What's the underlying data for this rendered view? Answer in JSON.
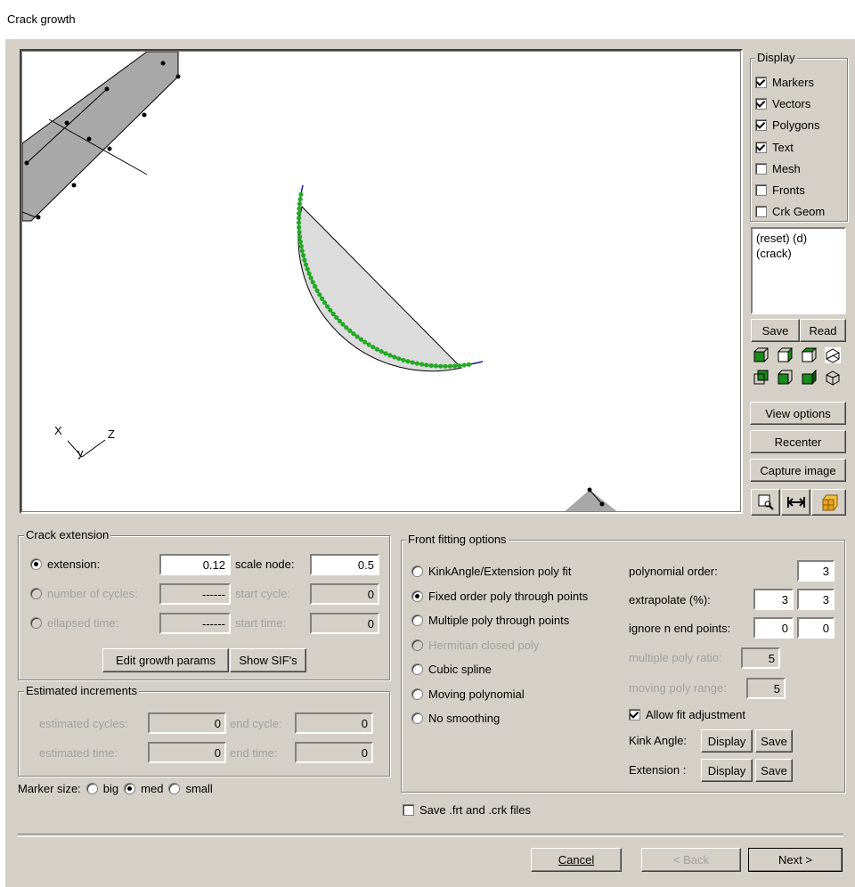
{
  "window": {
    "title": "Crack growth"
  },
  "display": {
    "group_label": "Display",
    "items": [
      {
        "label": "Markers",
        "checked": true
      },
      {
        "label": "Vectors",
        "checked": true
      },
      {
        "label": "Polygons",
        "checked": true
      },
      {
        "label": "Text",
        "checked": true
      },
      {
        "label": "Mesh",
        "checked": false
      },
      {
        "label": "Fronts",
        "checked": false
      },
      {
        "label": "Crk Geom",
        "checked": false
      }
    ],
    "list_items": [
      "(reset) (d)",
      "(crack)"
    ],
    "save_label": "Save",
    "read_label": "Read",
    "view_options_label": "View options",
    "recenter_label": "Recenter",
    "capture_label": "Capture image"
  },
  "axes": {
    "x": "X",
    "y": "y",
    "z": "Z"
  },
  "crack_extension": {
    "group_label": "Crack extension",
    "extension_label": "extension:",
    "extension_value": "0.12",
    "scale_node_label": "scale node:",
    "scale_node_value": "0.5",
    "cycles_label": "number of cycles:",
    "cycles_value": "------",
    "start_cycle_label": "start cycle:",
    "start_cycle_value": "0",
    "time_label": "ellapsed time:",
    "time_value": "------",
    "start_time_label": "start time:",
    "start_time_value": "0",
    "edit_button": "Edit growth params",
    "sif_button": "Show SIF's"
  },
  "estimated": {
    "group_label": "Estimated increments",
    "cycles_label": "estimated cycles:",
    "cycles_value": "0",
    "end_cycle_label": "end cycle:",
    "end_cycle_value": "0",
    "time_label": "estimated time:",
    "time_value": "0",
    "end_time_label": "end time:",
    "end_time_value": "0"
  },
  "marker_size": {
    "label": "Marker size:",
    "options": [
      "big",
      "med",
      "small"
    ],
    "selected": "med"
  },
  "front_fitting": {
    "group_label": "Front fitting options",
    "options": [
      {
        "label": "KinkAngle/Extension poly fit",
        "selected": false,
        "enabled": true
      },
      {
        "label": "Fixed order poly through points",
        "selected": true,
        "enabled": true
      },
      {
        "label": "Multiple poly through points",
        "selected": false,
        "enabled": true
      },
      {
        "label": "Hermitian closed poly",
        "selected": false,
        "enabled": false
      },
      {
        "label": "Cubic spline",
        "selected": false,
        "enabled": true
      },
      {
        "label": "Moving polynomial",
        "selected": false,
        "enabled": true
      },
      {
        "label": "No smoothing",
        "selected": false,
        "enabled": true
      }
    ],
    "poly_order_label": "polynomial order:",
    "poly_order_value": "3",
    "extrapolate_label": "extrapolate (%):",
    "extrapolate_a": "3",
    "extrapolate_b": "3",
    "ignore_label": "ignore n end points:",
    "ignore_a": "0",
    "ignore_b": "0",
    "multi_ratio_label": "multiple poly ratio:",
    "multi_ratio_value": "5",
    "moving_range_label": "moving poly range:",
    "moving_range_value": "5",
    "allow_fit_label": "Allow fit adjustment",
    "allow_fit_checked": true,
    "kink_label": "Kink Angle:",
    "extension_label": "Extension :",
    "display_button": "Display",
    "save_button": "Save"
  },
  "save_files_label": "Save .frt and .crk files",
  "footer": {
    "cancel": "Cancel",
    "back": "< Back",
    "next": "Next >"
  },
  "colors": {
    "dialog": "#d4d0c8",
    "marker": "#22aa22",
    "front": "#1a1aa0",
    "mesh": "#a8a8a8"
  }
}
